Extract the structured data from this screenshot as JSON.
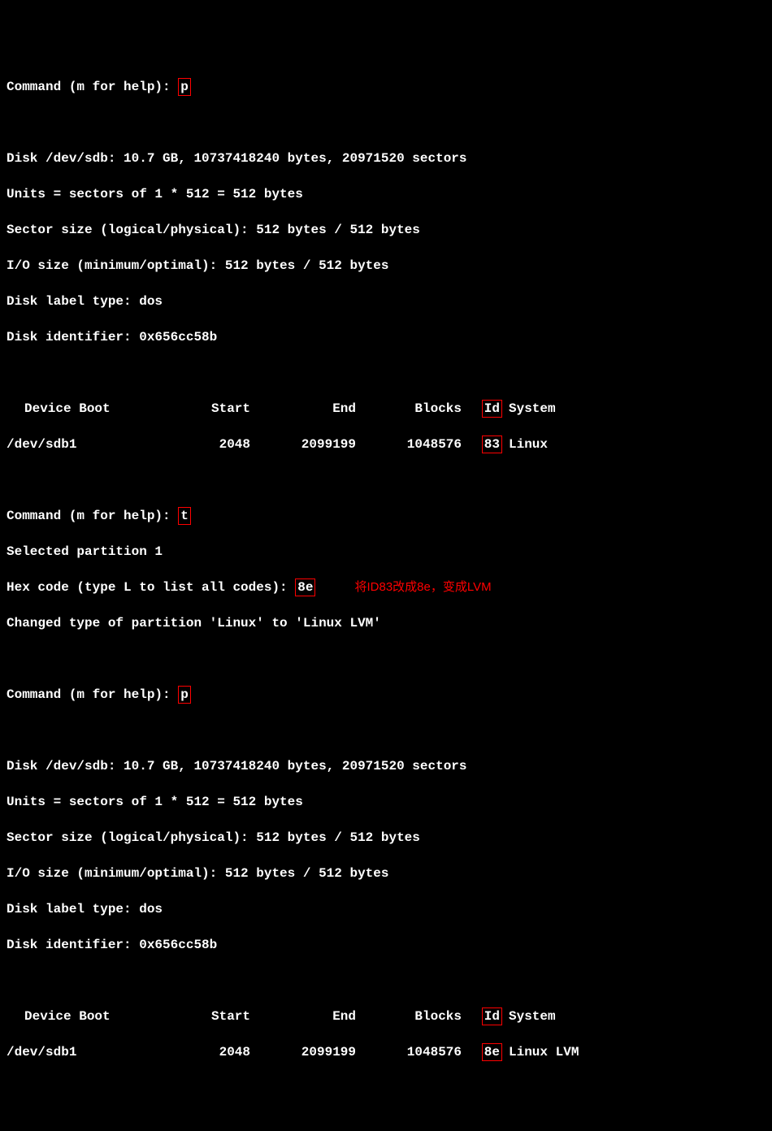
{
  "prompts": {
    "cmd_label": "Command (m for help): ",
    "p1": "p",
    "t": "t",
    "hex_label": "Hex code (type L to list all codes): ",
    "hex_val": "8e",
    "p2": "p",
    "selected": "Selected partition 1",
    "changed": "Changed type of partition 'Linux' to 'Linux LVM'"
  },
  "disk_info": {
    "l1": "Disk /dev/sdb: 10.7 GB, 10737418240 bytes, 20971520 sectors",
    "l2": "Units = sectors of 1 * 512 = 512 bytes",
    "l3": "Sector size (logical/physical): 512 bytes / 512 bytes",
    "l4": "I/O size (minimum/optimal): 512 bytes / 512 bytes",
    "l5": "Disk label type: dos",
    "l6": "Disk identifier: 0x656cc58b"
  },
  "table": {
    "hdr_device": "Device Boot",
    "hdr_start": "Start",
    "hdr_end": "End",
    "hdr_blocks": "Blocks",
    "hdr_id": "Id",
    "hdr_system": "System",
    "row1": {
      "device": "/dev/sdb1",
      "start": "2048",
      "end": "2099199",
      "blocks": "1048576",
      "id": "83",
      "system": "Linux"
    },
    "row2": {
      "device": "/dev/sdb1",
      "start": "2048",
      "end": "2099199",
      "blocks": "1048576",
      "id": "8e",
      "system": "Linux LVM"
    }
  },
  "annotation": "将ID83改成8e，变成LVM"
}
